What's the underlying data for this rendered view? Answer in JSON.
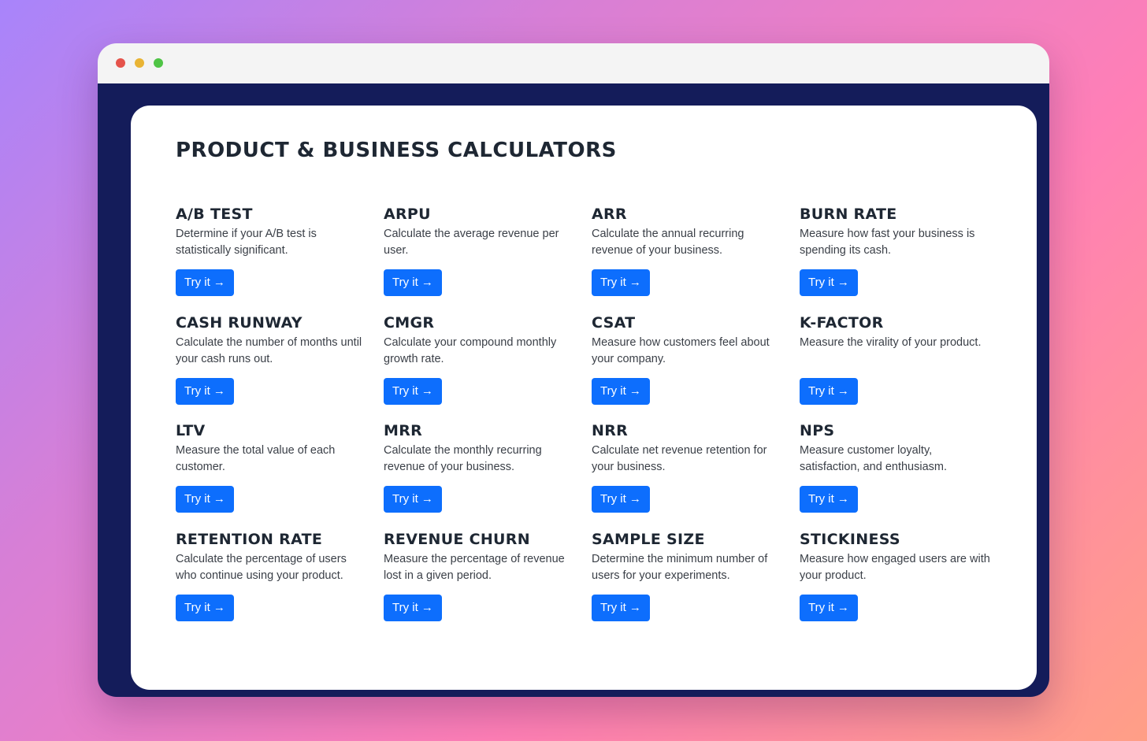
{
  "window": {
    "controls": [
      "close-dot",
      "minimize-dot",
      "maximize-dot"
    ]
  },
  "page": {
    "title": "Product & Business Calculators",
    "button_label": "Try it →",
    "calculators": [
      {
        "name": "A/B Test",
        "description": "Determine if your A/B test is statistically significant."
      },
      {
        "name": "ARPU",
        "description": "Calculate the average revenue per user."
      },
      {
        "name": "ARR",
        "description": "Calculate the annual recurring revenue of your business."
      },
      {
        "name": "Burn Rate",
        "description": "Measure how fast your business is spending its cash."
      },
      {
        "name": "Cash Runway",
        "description": "Calculate the number of months until your cash runs out."
      },
      {
        "name": "CMGR",
        "description": "Calculate your compound monthly growth rate."
      },
      {
        "name": "CSAT",
        "description": "Measure how customers feel about your company."
      },
      {
        "name": "K-Factor",
        "description": "Measure the virality of your product."
      },
      {
        "name": "LTV",
        "description": "Measure the total value of each customer."
      },
      {
        "name": "MRR",
        "description": "Calculate the monthly recurring revenue of your business."
      },
      {
        "name": "NRR",
        "description": "Calculate net revenue retention for your business."
      },
      {
        "name": "NPS",
        "description": "Measure customer loyalty, satisfaction, and enthusiasm."
      },
      {
        "name": "Retention Rate",
        "description": "Calculate the percentage of users who continue using your product."
      },
      {
        "name": "Revenue Churn",
        "description": "Measure the percentage of revenue lost in a given period."
      },
      {
        "name": "Sample Size",
        "description": "Determine the minimum number of users for your experiments."
      },
      {
        "name": "Stickiness",
        "description": "Measure how engaged users are with your product."
      }
    ]
  },
  "colors": {
    "accent": "#0d6efd",
    "frame": "#141c5a",
    "heading": "#1e2733",
    "dot_red": "#e5534b",
    "dot_yellow": "#e9b434",
    "dot_green": "#4fc445"
  }
}
